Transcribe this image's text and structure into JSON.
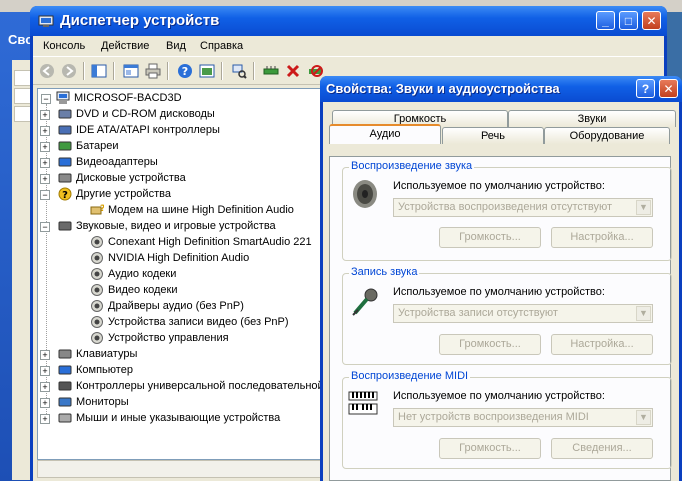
{
  "device_manager": {
    "title": "Диспетчер устройств",
    "menu": [
      "Консоль",
      "Действие",
      "Вид",
      "Справка"
    ],
    "tree": {
      "root": "MICROSOF-BACD3D",
      "items": [
        {
          "label": "DVD и CD-ROM дисководы",
          "level": 1
        },
        {
          "label": "IDE ATA/ATAPI контроллеры",
          "level": 1
        },
        {
          "label": "Батареи",
          "level": 1
        },
        {
          "label": "Видеоадаптеры",
          "level": 1
        },
        {
          "label": "Дисковые устройства",
          "level": 1
        },
        {
          "label": "Другие устройства",
          "level": 1
        },
        {
          "label": "Модем на шине High Definition Audio",
          "level": 2
        },
        {
          "label": "Звуковые, видео и игровые устройства",
          "level": 1
        },
        {
          "label": "Conexant High Definition SmartAudio 221",
          "level": 2
        },
        {
          "label": "NVIDIA High Definition Audio",
          "level": 2
        },
        {
          "label": "Аудио кодеки",
          "level": 2
        },
        {
          "label": "Видео кодеки",
          "level": 2
        },
        {
          "label": "Драйверы аудио (без PnP)",
          "level": 2
        },
        {
          "label": "Устройства записи видео (без PnP)",
          "level": 2
        },
        {
          "label": "Устройство управления",
          "level": 2
        },
        {
          "label": "Клавиатуры",
          "level": 1
        },
        {
          "label": "Компьютер",
          "level": 1
        },
        {
          "label": "Контроллеры универсальной последовательной шины",
          "level": 1
        },
        {
          "label": "Мониторы",
          "level": 1
        },
        {
          "label": "Мыши и иные указывающие устройства",
          "level": 1
        }
      ]
    }
  },
  "background": {
    "left_window_title": "Свойс"
  },
  "dialog": {
    "title": "Свойства: Звуки и аудиоустройства",
    "help_btn": "?",
    "close_btn": "✕",
    "tabs_row1": [
      "Громкость",
      "Звуки"
    ],
    "tabs_row2": [
      "Аудио",
      "Речь",
      "Оборудование"
    ],
    "playback": {
      "group_title": "Воспроизведение звука",
      "default_label": "Используемое по умолчанию устройство:",
      "device": "Устройства воспроизведения отсутствуют",
      "volume_btn": "Громкость...",
      "settings_btn": "Настройка..."
    },
    "recording": {
      "group_title": "Запись звука",
      "default_label": "Используемое по умолчанию устройство:",
      "device": "Устройства записи отсутствуют",
      "volume_btn": "Громкость...",
      "settings_btn": "Настройка..."
    },
    "midi": {
      "group_title": "Воспроизведение MIDI",
      "default_label": "Используемое по умолчанию устройство:",
      "device": "Нет устройств воспроизведения MIDI",
      "volume_btn": "Громкость...",
      "info_btn": "Сведения..."
    }
  }
}
